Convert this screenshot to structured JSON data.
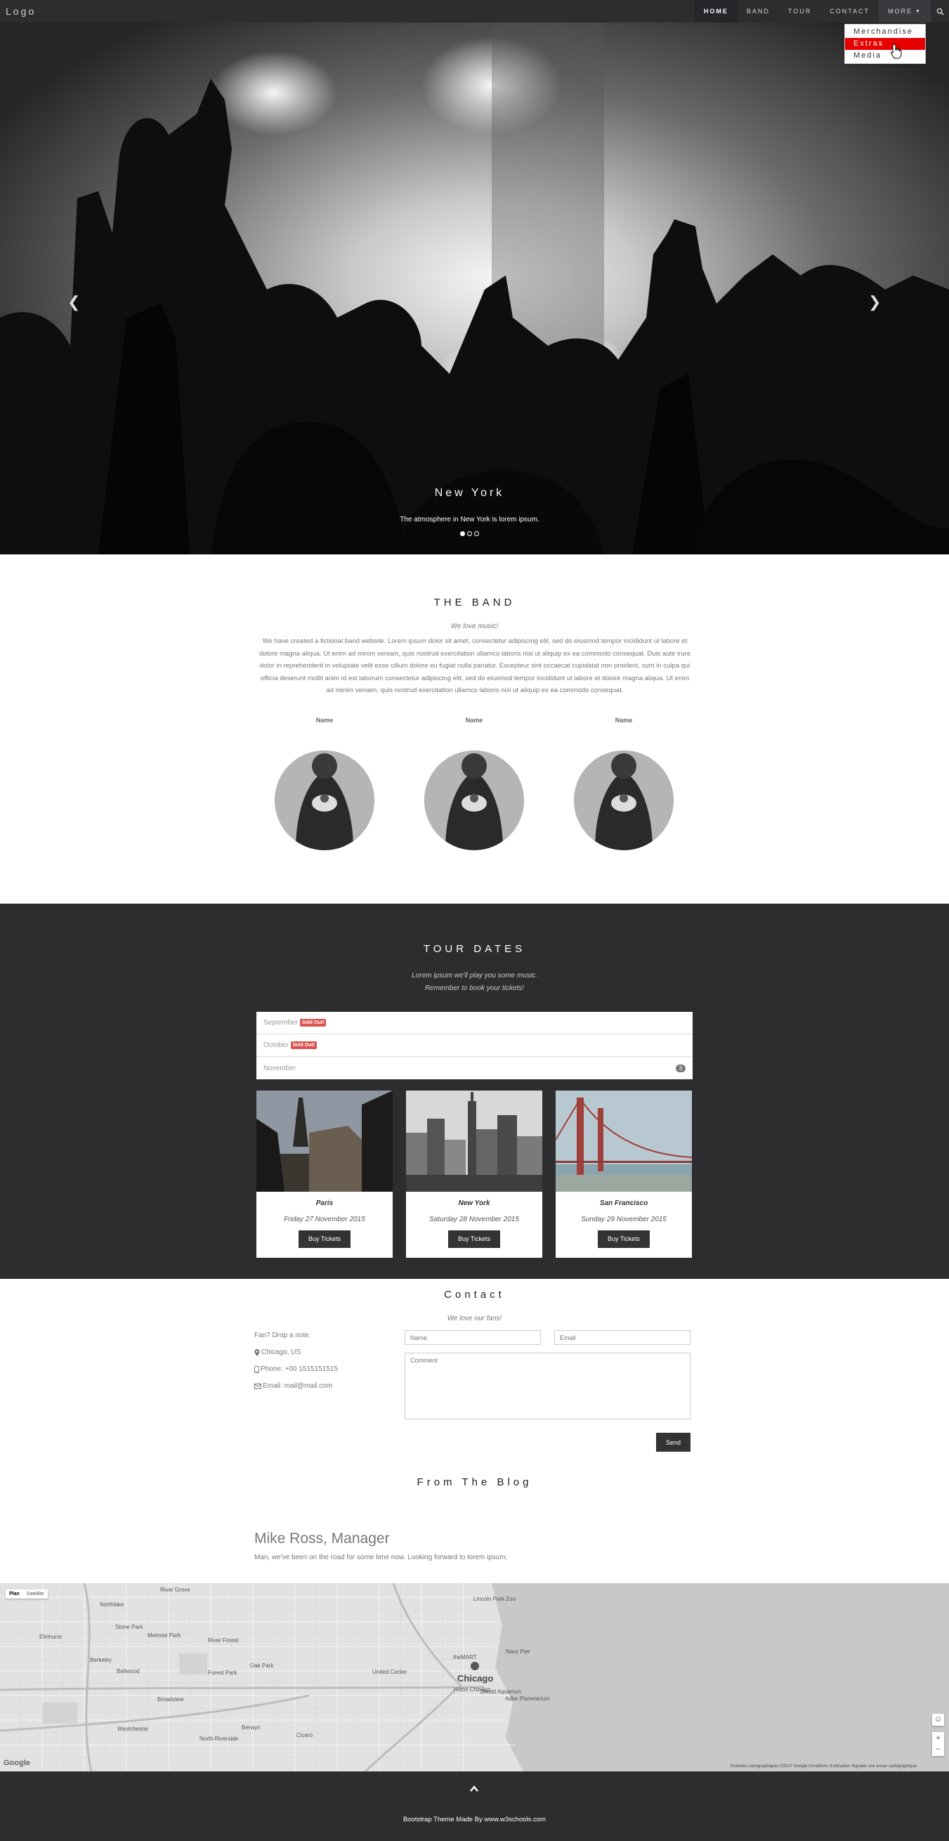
{
  "nav": {
    "logo": "Logo",
    "items": [
      {
        "label": "HOME",
        "active": true
      },
      {
        "label": "BAND"
      },
      {
        "label": "TOUR"
      },
      {
        "label": "CONTACT"
      }
    ],
    "more_label": "MORE",
    "dropdown": [
      "Merchandise",
      "Extras",
      "Media"
    ],
    "dropdown_selected": "Extras"
  },
  "hero": {
    "caption_title": "New York",
    "caption_text": "The atmosphere in New York is lorem ipsum.",
    "slide_count": 3,
    "active_slide": 1
  },
  "band": {
    "title": "THE BAND",
    "tagline": "We love music!",
    "description": "We have created a fictional band website. Lorem ipsum dolor sit amet, consectetur adipiscing elit, sed do eiusmod tempor incididunt ut labore et dolore magna aliqua. Ut enim ad minim veniam, quis nostrud exercitation ullamco laboris nisi ut aliquip ex ea commodo consequat. Duis aute irure dolor in reprehenderit in voluptate velit esse cillum dolore eu fugiat nulla pariatur. Excepteur sint occaecat cupidatat non proident, sunt in culpa qui officia deserunt mollit anim id est laborum consectetur adipiscing elit, sed do eiusmod tempor incididunt ut labore et dolore magna aliqua. Ut enim ad minim veniam, quis nostrud exercitation ullamco laboris nisi ut aliquip ex ea commodo consequat.",
    "members": [
      "Name",
      "Name",
      "Name"
    ]
  },
  "tour": {
    "title": "TOUR DATES",
    "lead_1": "Lorem ipsum we'll play you some music.",
    "lead_2": "Remember to book your tickets!",
    "months": [
      {
        "label": "September",
        "status": "Sold Out!"
      },
      {
        "label": "October",
        "status": "Sold Out!"
      },
      {
        "label": "November",
        "count": "3"
      }
    ],
    "cities": [
      {
        "name": "Paris",
        "date": "Friday 27 November 2015",
        "button": "Buy Tickets"
      },
      {
        "name": "New York",
        "date": "Saturday 28 November 2015",
        "button": "Buy Tickets"
      },
      {
        "name": "San Francisco",
        "date": "Sunday 29 November 2015",
        "button": "Buy Tickets"
      }
    ]
  },
  "contact": {
    "title": "Contact",
    "tagline": "We love our fans!",
    "drop_note": "Fan? Drop a note.",
    "location": "Chicago, US",
    "phone": "Phone: +00 1515151515",
    "email": "Email: mail@mail.com",
    "name_placeholder": "Name",
    "email_placeholder": "Email",
    "comment_placeholder": "Comment",
    "send_label": "Send"
  },
  "blog": {
    "title": "From The Blog",
    "author": "Mike Ross, Manager",
    "text": "Man, we've been on the road for some time now. Looking forward to lorem ipsum."
  },
  "map": {
    "tab_map": "Plan",
    "tab_satellite": "Satellite",
    "footer": "Données cartographiques ©2017 Google    Conditions d'utilisation    Signaler une erreur cartographique",
    "google": "Google",
    "labels": [
      "River Grove",
      "Northlake",
      "Stone Park",
      "Melrose Park",
      "Elmhurst",
      "Berkeley",
      "River Forest",
      "Oak Park",
      "Forest Park",
      "Bellwood",
      "Broadview",
      "Westchester",
      "Berwyn",
      "North Riverside",
      "Cicero",
      "Lincoln Park Zoo",
      "Navy Pier",
      "theMART",
      "United Center",
      "Hilton Chicago",
      "Chicago",
      "Shedd Aquarium",
      "Adler Planetarium"
    ]
  },
  "footer": {
    "text": "Bootstrap Theme Made By www.w3schools.com"
  }
}
